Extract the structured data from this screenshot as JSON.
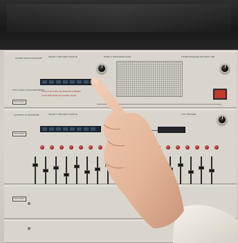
{
  "photo": {
    "subject": "",
    "colors": {
      "frame": "#1c1c1c",
      "panel": "#d9d5cd",
      "knob": "#111111",
      "red_button": "#c23a2a",
      "led": "#922222",
      "skin": "#e9c2a8",
      "sleeve": "#efe9e1"
    }
  },
  "panel_a": {
    "title": "CHORD WAVE PROGRAM",
    "section_1": "SELECT TRIGGER SOURCE",
    "section_2": "MODE & PROGRAM LEVEL",
    "section_3": "FILTER TRIGGER SOURCE ONE",
    "side_label": "FOR & WAR SYNCHRONIZERS",
    "tag": "PROGRAM",
    "note_line_1": "CLOCK EX FOR OR REMOTE PRESET",
    "note_line_2": "SYNCHRONIZE TO CHORD WAVE"
  },
  "panel_b": {
    "title": "CONTROL IN PROGRAM",
    "section_1": "SELECT TRIGGER SOURCE",
    "section_2": "LFO TRIGGER",
    "tag": "PROGRAM"
  },
  "panel_c": {
    "tag": "PROGRAM"
  }
}
